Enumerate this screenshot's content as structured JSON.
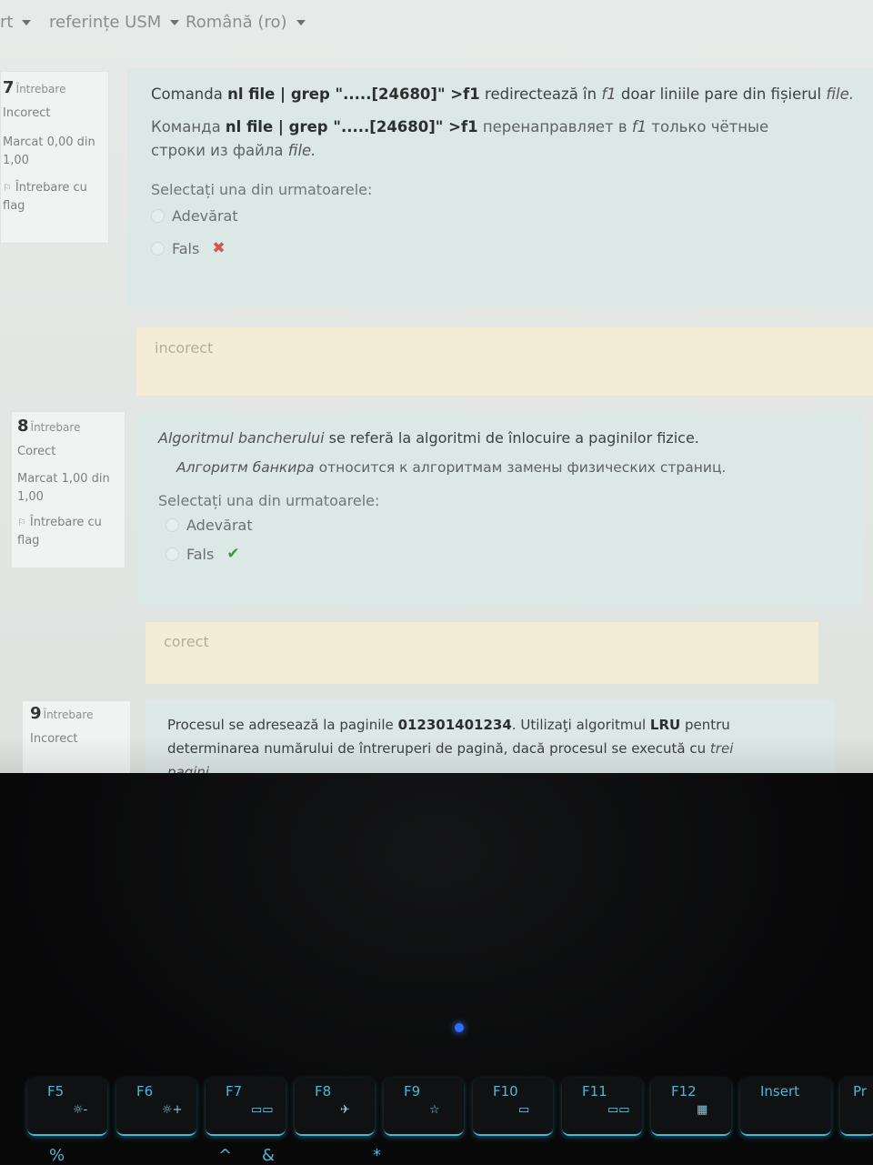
{
  "nav": {
    "items": [
      "rt",
      "referințe USM",
      "Română (ro)"
    ]
  },
  "q7": {
    "number": "7",
    "label": "Întrebare",
    "state": "Incorect",
    "grade": "Marcat 0,00 din 1,00",
    "flag": "Întrebare cu flag",
    "ro_prefix": "Comanda ",
    "ro_cmd": "nl file | grep \".....[24680]\" >f1",
    "ro_mid": " redirectează în ",
    "ro_f1": "f1",
    "ro_mid2": " doar liniile pare din fișierul ",
    "ro_file": "file.",
    "ru_prefix": "Команда ",
    "ru_cmd": "nl file | grep \".....[24680]\" >f1",
    "ru_mid": " перенаправляет в ",
    "ru_f1": "f1",
    "ru_mid2": " только чётные строки из файла ",
    "ru_file": "file.",
    "prompt": "Selectați una din urmatoarele:",
    "option_true": "Adevărat",
    "option_false": "Fals",
    "feedback": "incorect"
  },
  "q8": {
    "number": "8",
    "label": "Întrebare",
    "state": "Corect",
    "grade": "Marcat 1,00 din 1,00",
    "flag": "Întrebare cu flag",
    "ro_italic": "Algoritmul bancherului",
    "ro_rest": " se referă la algoritmi de înlocuire a paginilor fizice.",
    "ru_italic": "Алгоритм банкира",
    "ru_rest": " относится к алгоритмам замены физических страниц.",
    "prompt": "Selectați una din urmatoarele:",
    "option_true": "Adevărat",
    "option_false": "Fals",
    "feedback": "corect"
  },
  "q9": {
    "number": "9",
    "label": "Întrebare",
    "state": "Incorect",
    "text_a": "Procesul se adresează la paginile ",
    "pages": "012301401234",
    "text_b": ". Utilizaţi algoritmul ",
    "algo": "LRU",
    "text_c": " pentru determinarea numărului de întreruperi de pagină, dacă procesul se execută cu ",
    "frames": "trei pagini"
  },
  "keyboard": {
    "keys": [
      "F5",
      "F6",
      "F7",
      "F8",
      "F9",
      "F10",
      "F11",
      "F12",
      "Insert",
      "Pr"
    ],
    "symbols": [
      "☼-",
      "☼+",
      "▭▭",
      "✈",
      "☆",
      "▭",
      "▭▭",
      "▦",
      "",
      ""
    ],
    "row2": [
      "%",
      "^",
      "&",
      "*"
    ]
  },
  "colors": {
    "card": "#dce8e6",
    "feedback": "#f5ecd6",
    "wrong": "#d9534f",
    "right": "#3c9a3c",
    "key_glow": "#3fb9d9"
  }
}
